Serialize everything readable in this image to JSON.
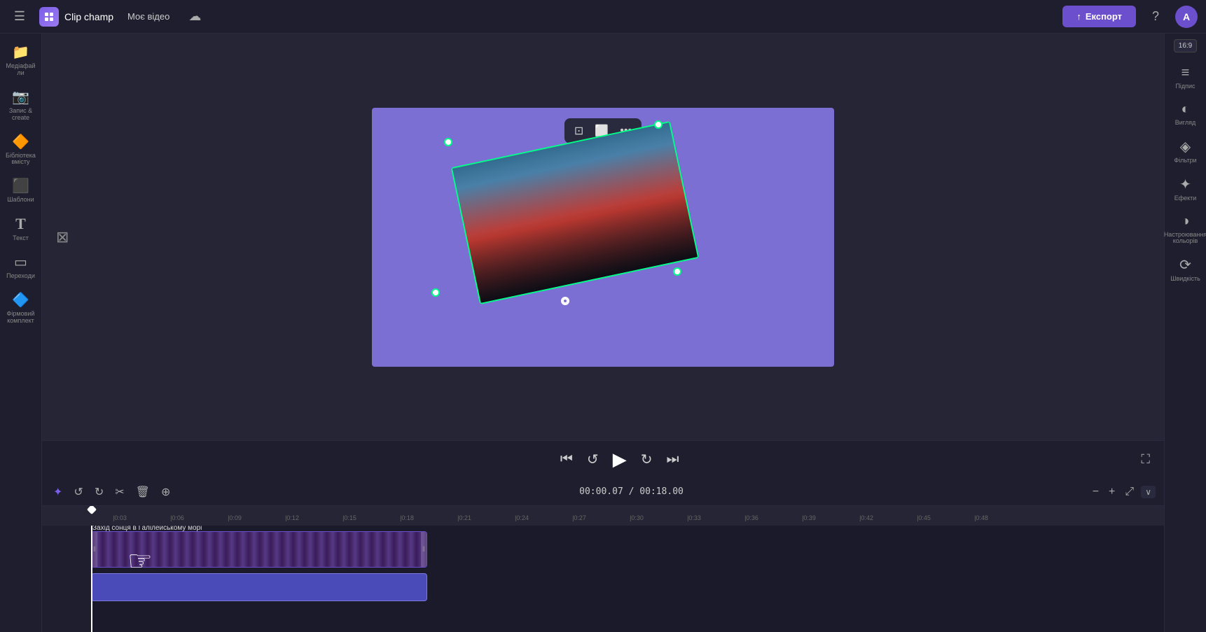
{
  "app": {
    "title": "Clip champ",
    "my_videos_label": "Моє відео",
    "export_label": "Експорт"
  },
  "left_sidebar": {
    "items": [
      {
        "id": "media",
        "icon": "📁",
        "label": "Медіафайли"
      },
      {
        "id": "record",
        "icon": "📷",
        "label": "Запис &amp; create"
      },
      {
        "id": "library",
        "icon": "🔶",
        "label": "Бібліотека вмісту"
      },
      {
        "id": "templates",
        "icon": "⬛",
        "label": "Шаблони"
      },
      {
        "id": "text",
        "icon": "T",
        "label": "Текст"
      },
      {
        "id": "transitions",
        "icon": "▭",
        "label": "Переходи"
      },
      {
        "id": "brand",
        "icon": "🔷",
        "label": "Фірмовий комплект"
      }
    ]
  },
  "right_sidebar": {
    "aspect_ratio": "16:9",
    "items": [
      {
        "id": "podpysy",
        "icon": "≡",
        "label": "Підпис"
      },
      {
        "id": "vyglyad",
        "icon": "◐",
        "label": "Вигляд"
      },
      {
        "id": "filtry",
        "icon": "◈",
        "label": "Фільтри"
      },
      {
        "id": "efekty",
        "icon": "✦",
        "label": "Ефекти"
      },
      {
        "id": "color",
        "icon": "◑",
        "label": "Настроювання кольорів"
      },
      {
        "id": "speed",
        "icon": "⟳",
        "label": "Швидкість"
      }
    ]
  },
  "preview": {
    "toolbar": {
      "crop_icon": "⊡",
      "frame_icon": "⬜",
      "more_icon": "···"
    }
  },
  "playback": {
    "time_current": "00:00.07",
    "time_total": "00:18.00",
    "time_display": "00:00.07 / 00:18.00"
  },
  "timeline": {
    "toolbar": {
      "snap_icon": "✦",
      "undo_icon": "↺",
      "redo_icon": "↻",
      "cut_icon": "✂",
      "delete_icon": "🗑",
      "add_media_icon": "⊕"
    },
    "time_display": "00:00.07 / 00:18.00",
    "ruler_marks": [
      "0:03",
      "0:06",
      "0:09",
      "0:12",
      "0:15",
      "0:18",
      "0:21",
      "0:24",
      "0:27",
      "0:30",
      "0:33",
      "0:36",
      "0:39",
      "0:42",
      "0:45",
      "0:48"
    ],
    "clip_label": "Захід сонця в Галілейському морі"
  }
}
